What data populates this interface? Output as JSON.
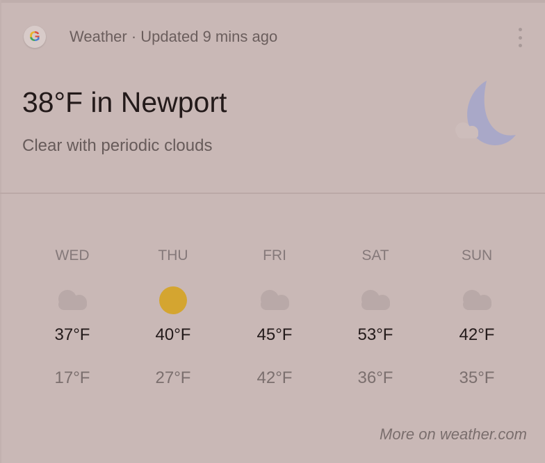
{
  "header": {
    "logo": "google-g-logo",
    "source": "Weather · Updated 9 mins ago",
    "menu_icon": "more-vert-icon"
  },
  "current": {
    "title": "38°F in Newport",
    "condition": "Clear with periodic clouds",
    "icon": "moon-with-cloud-icon"
  },
  "forecast": [
    {
      "day": "WED",
      "icon": "cloud-icon",
      "high": "37°F",
      "low": "17°F"
    },
    {
      "day": "THU",
      "icon": "sun-icon",
      "high": "40°F",
      "low": "27°F"
    },
    {
      "day": "FRI",
      "icon": "cloud-icon",
      "high": "45°F",
      "low": "42°F"
    },
    {
      "day": "SAT",
      "icon": "cloud-icon",
      "high": "53°F",
      "low": "36°F"
    },
    {
      "day": "SUN",
      "icon": "cloud-icon",
      "high": "42°F",
      "low": "35°F"
    }
  ],
  "footer": {
    "link": "More on weather.com"
  },
  "colors": {
    "background": "#c9b8b6",
    "sun": "#d4a530",
    "cloud": "#b9a9a8",
    "moon": "#a9a8c8"
  }
}
